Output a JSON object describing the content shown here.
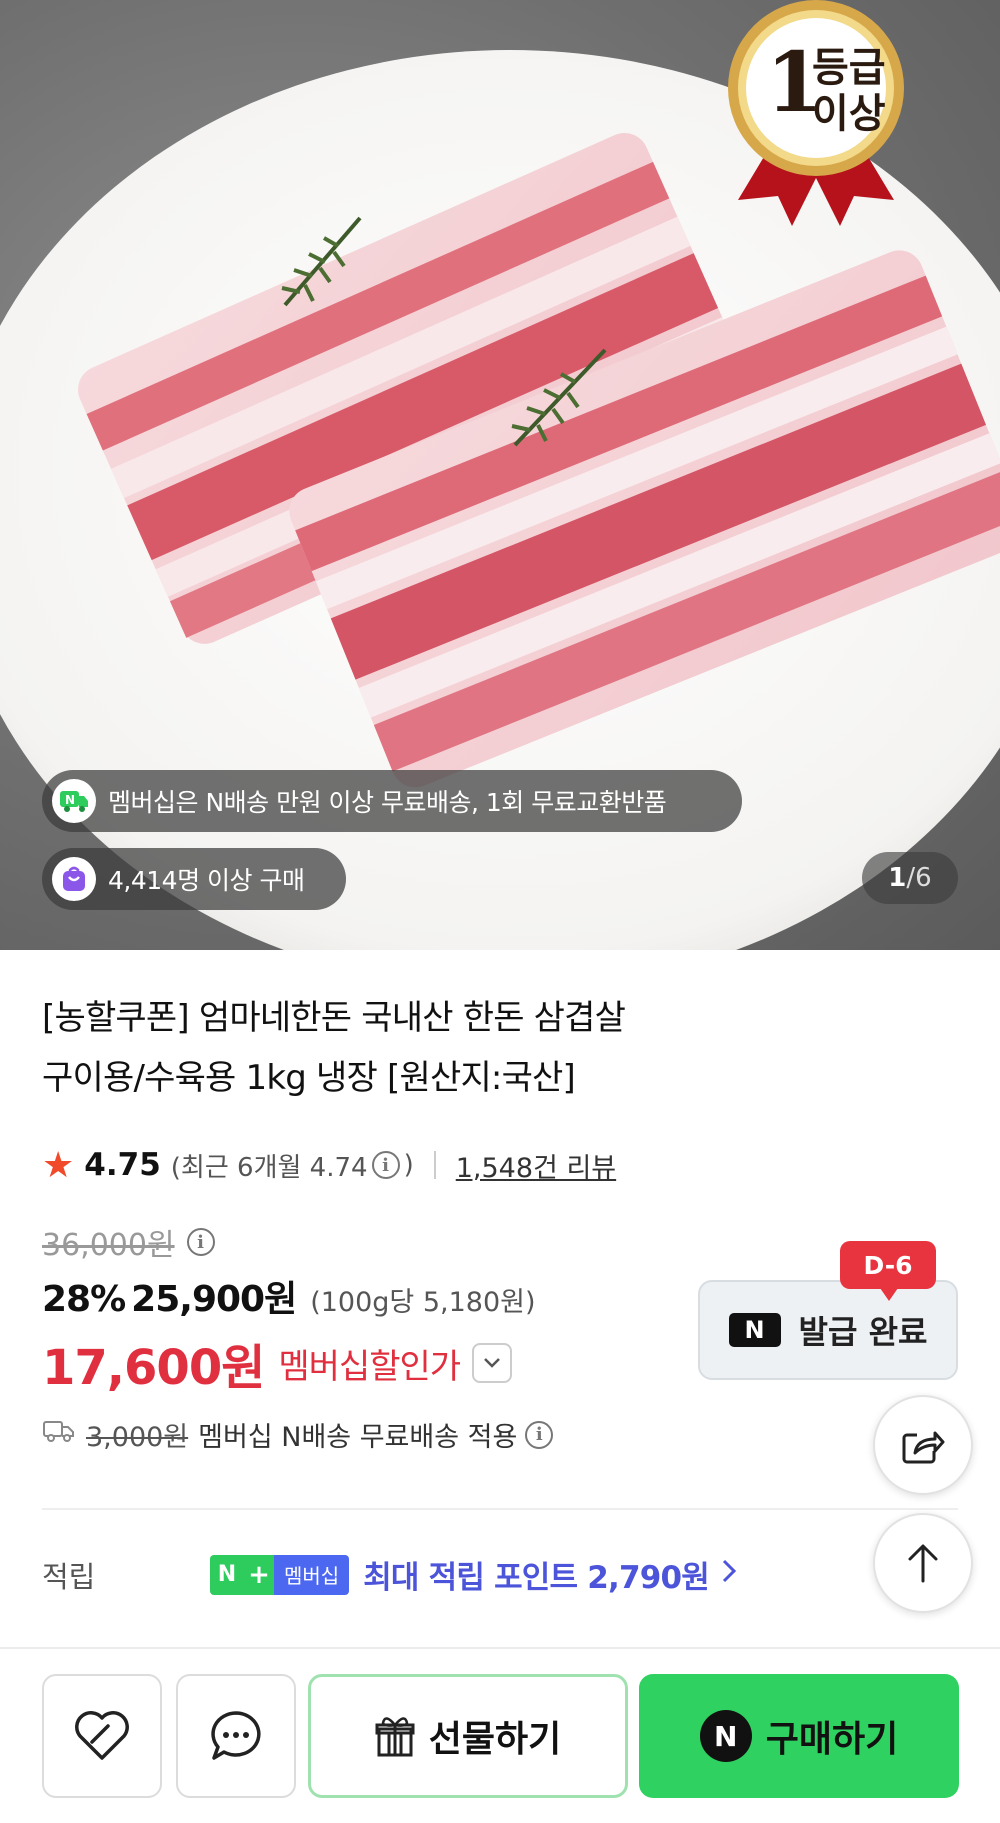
{
  "hero": {
    "badge": {
      "number": "1",
      "line1": "등급",
      "line2": "이상"
    },
    "membership_notice": "멤버십은 N배송 만원 이상 무료배송, 1회 무료교환반품",
    "purchase_count": "4,414명 이상 구매",
    "counter": {
      "current": "1",
      "separator": "/",
      "total": "6"
    }
  },
  "product": {
    "title_line1": "[농할쿠폰] 엄마네한돈 국내산 한돈 삼겹살",
    "title_line2": "구이용/수육용 1kg 냉장 [원산지:국산]"
  },
  "rating": {
    "score": "4.75",
    "recent_prefix": "(최근 6개월 4.74",
    "recent_suffix": ")",
    "reviews": "1,548건 리뷰"
  },
  "price": {
    "original": "36,000원",
    "discount_percent": "28%",
    "sale_price": "25,900원",
    "unit_price": "(100g당 5,180원)",
    "member_price": "17,600원",
    "member_label": "멤버십할인가"
  },
  "coupon": {
    "logo": "N",
    "label": "발급 완료",
    "d_tag": "D-6"
  },
  "shipping": {
    "old_fee": "3,000원",
    "text": "멤버십 N배송 무료배송 적용"
  },
  "points": {
    "label": "적립",
    "badge_n": "N",
    "badge_plus": "+",
    "badge_member": "멤버십",
    "text": "최대 적립 포인트 2,790원"
  },
  "actions": {
    "gift_label": "선물하기",
    "buy_logo": "N",
    "buy_label": "구매하기"
  },
  "colors": {
    "member_red": "#e03040",
    "point_blue": "#4c55d9",
    "buy_green": "#2fd160",
    "dtag_red": "#e8343e"
  }
}
